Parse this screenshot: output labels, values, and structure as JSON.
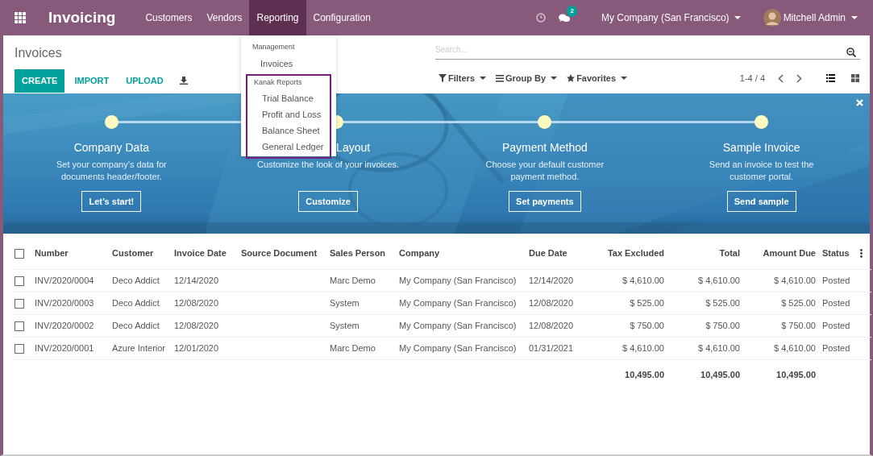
{
  "app": {
    "name": "Invoicing"
  },
  "menu": [
    {
      "label": "Customers",
      "selected": false
    },
    {
      "label": "Vendors",
      "selected": false
    },
    {
      "label": "Reporting",
      "selected": true
    },
    {
      "label": "Configuration",
      "selected": false
    }
  ],
  "systray": {
    "messages_count": "2",
    "company": "My Company (San Francisco)",
    "user": "Mitchell Admin"
  },
  "dropdown": {
    "sections": [
      {
        "title": "Management",
        "highlighted": false,
        "items": [
          "Invoices"
        ]
      },
      {
        "title": "Kanak Reports",
        "highlighted": true,
        "items": [
          "Trial Balance",
          "Profit and Loss",
          "Balance Sheet",
          "General Ledger"
        ]
      }
    ]
  },
  "control_panel": {
    "title": "Invoices",
    "buttons": [
      {
        "label": "CREATE",
        "kind": "primary"
      },
      {
        "label": "IMPORT",
        "kind": "link"
      },
      {
        "label": "UPLOAD",
        "kind": "link"
      }
    ],
    "search": {
      "placeholder": "Search..."
    },
    "filters": [
      {
        "label": "Filters",
        "kind": "filter"
      },
      {
        "label": "Group By",
        "kind": "group"
      },
      {
        "label": "Favorites",
        "kind": "favorite"
      }
    ],
    "pager": "1-4 / 4",
    "views": [
      {
        "kind": "list",
        "selected": true
      },
      {
        "kind": "kanban",
        "selected": false
      }
    ]
  },
  "banner": {
    "kind": "picture",
    "steps": [
      {
        "title": "Company Data",
        "text": "Set your company’s data for documents header/footer.",
        "button": "Let’s start!"
      },
      {
        "title": "Layout",
        "text": "Customize the look of your invoices.",
        "button": "Customize"
      },
      {
        "title": "Payment Method",
        "text": "Choose your default customer payment method.",
        "button": "Set payments"
      },
      {
        "title": "Sample Invoice",
        "text": "Send an invoice to test the customer portal.",
        "button": "Send sample"
      }
    ]
  },
  "table": {
    "select_all": false,
    "columns": [
      {
        "label": "Number"
      },
      {
        "label": "Customer"
      },
      {
        "label": "Invoice Date"
      },
      {
        "label": "Source Document"
      },
      {
        "label": "Sales Person"
      },
      {
        "label": "Company"
      },
      {
        "label": "Due Date"
      },
      {
        "label": "Tax Excluded",
        "total": "10,495.00"
      },
      {
        "label": "Total",
        "total": "10,495.00"
      },
      {
        "label": "Amount Due",
        "total": "10,495.00"
      },
      {
        "label": "Status"
      }
    ],
    "rows": [
      {
        "selected": false,
        "cells": [
          "INV/2020/0004",
          "Deco Addict",
          "12/14/2020",
          "",
          "Marc Demo",
          "My Company (San Francisco)",
          "12/14/2020",
          "$ 4,610.00",
          "$ 4,610.00",
          "$ 4,610.00",
          "Posted"
        ]
      },
      {
        "selected": false,
        "cells": [
          "INV/2020/0003",
          "Deco Addict",
          "12/08/2020",
          "",
          "System",
          "My Company (San Francisco)",
          "12/08/2020",
          "$ 525.00",
          "$ 525.00",
          "$ 525.00",
          "Posted"
        ]
      },
      {
        "selected": false,
        "cells": [
          "INV/2020/0002",
          "Deco Addict",
          "12/08/2020",
          "",
          "System",
          "My Company (San Francisco)",
          "12/08/2020",
          "$ 750.00",
          "$ 750.00",
          "$ 750.00",
          "Posted"
        ]
      },
      {
        "selected": false,
        "cells": [
          "INV/2020/0001",
          "Azure Interior",
          "12/01/2020",
          "",
          "Marc Demo",
          "My Company (San Francisco)",
          "01/31/2021",
          "$ 4,610.00",
          "$ 4,610.00",
          "$ 4,610.00",
          "Posted"
        ]
      }
    ]
  }
}
